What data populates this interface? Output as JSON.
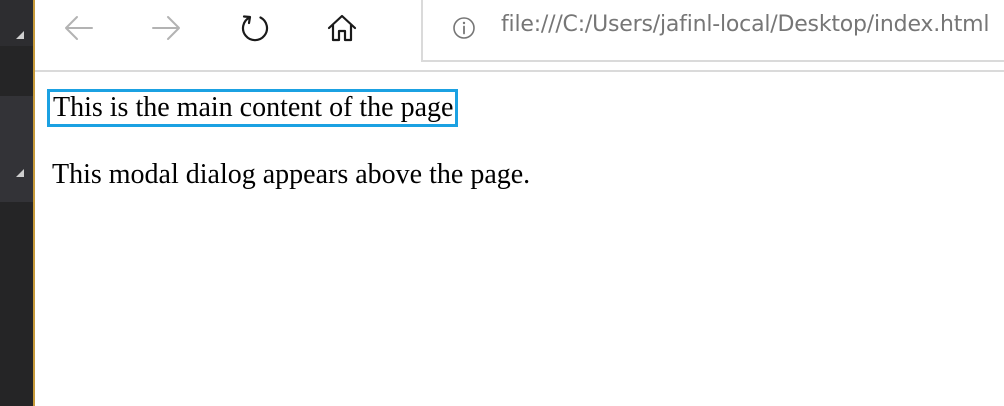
{
  "browser": {
    "address_bar": {
      "url": "file:///C:/Users/jafinl-local/Desktop/index.html"
    }
  },
  "page": {
    "main_content_text": "This is the main content of the page",
    "modal_dialog_text": "This modal dialog appears above the page."
  },
  "icons": {
    "back": "arrow-left-icon",
    "forward": "arrow-right-icon",
    "refresh": "refresh-icon",
    "home": "home-icon",
    "info": "info-icon"
  },
  "colors": {
    "focus_outline": "#1ba1e2",
    "url_text": "#767676",
    "side_strip": "#252526"
  }
}
